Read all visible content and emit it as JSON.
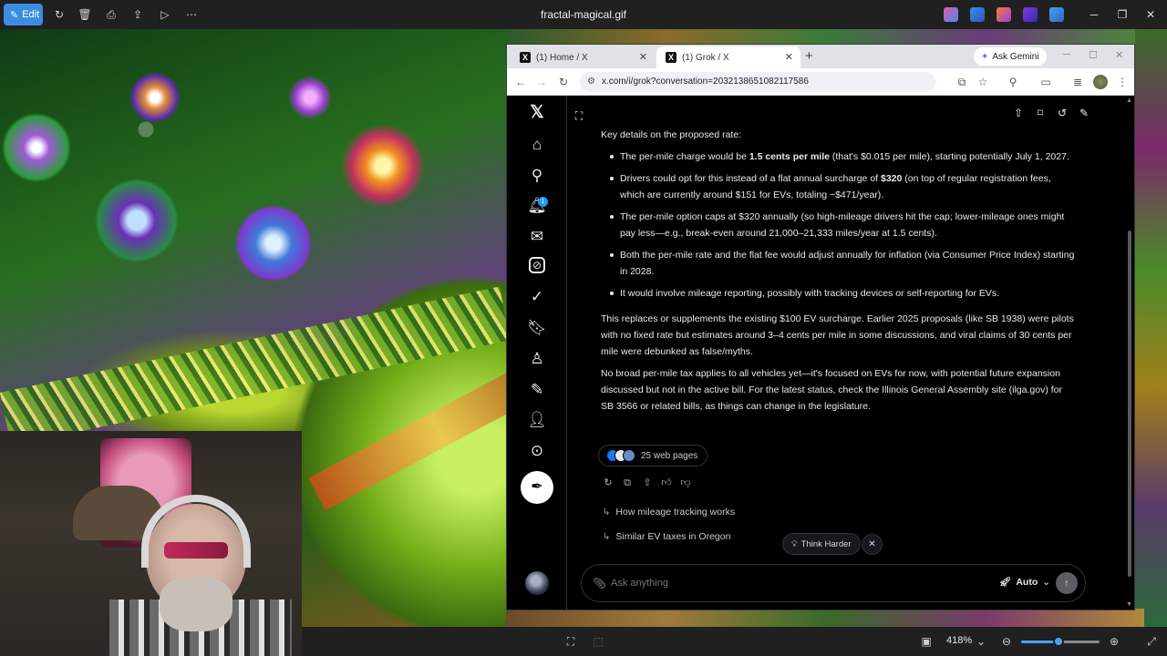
{
  "viewer": {
    "edit_label": "Edit",
    "file_title": "fractal-magical.gif",
    "zoom_level": "418%",
    "zoom_fraction": 0.48
  },
  "browser": {
    "tabs": [
      {
        "label": "(1) Home / X"
      },
      {
        "label": "(1) Grok / X"
      }
    ],
    "gemini_label": "Ask Gemini",
    "url": "x.com/i/grok?conversation=2032138651082117586"
  },
  "x": {
    "notification_count": "1",
    "answer": {
      "intro": "Key details on the proposed rate:",
      "bullets": [
        {
          "pre": "The per-mile charge would be ",
          "bold": "1.5 cents per mile",
          "post": " (that's $0.015 per mile), starting potentially July 1, 2027."
        },
        {
          "pre": "Drivers could opt for this instead of a flat annual surcharge of ",
          "bold": "$320",
          "post": " (on top of regular registration fees, which are currently around $151 for EVs, totaling ~$471/year)."
        },
        {
          "pre": "The per-mile option caps at $320 annually (so high-mileage drivers hit the cap; lower-mileage ones might pay less—e.g., break-even around 21,000–21,333 miles/year at 1.5 cents).",
          "bold": "",
          "post": ""
        },
        {
          "pre": "Both the per-mile rate and the flat fee would adjust annually for inflation (via Consumer Price Index) starting in 2028.",
          "bold": "",
          "post": ""
        },
        {
          "pre": "It would involve mileage reporting, possibly with tracking devices or self-reporting for EVs.",
          "bold": "",
          "post": ""
        }
      ],
      "para1": "This replaces or supplements the existing $100 EV surcharge. Earlier 2025 proposals (like SB 1938) were pilots with no fixed rate but estimates around 3–4 cents per mile in some discussions, and viral claims of 30 cents per mile were debunked as false/myths.",
      "para2": "No broad per-mile tax applies to all vehicles yet—it's focused on EVs for now, with potential future expansion discussed but not in the active bill. For the latest status, check the Illinois General Assembly site (ilga.gov) for SB 3566 or related bills, as things can change in the legislature."
    },
    "sources_label": "25 web pages",
    "followups": [
      "How mileage tracking works",
      "Similar EV taxes in Oregon"
    ],
    "think_harder_label": "Think Harder",
    "ask_placeholder": "Ask anything",
    "mode_label": "Auto"
  }
}
